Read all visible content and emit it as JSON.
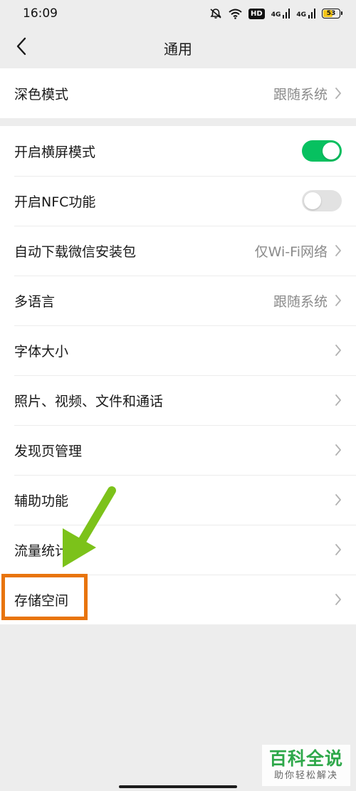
{
  "status_bar": {
    "time": "16:09",
    "hd_label": "HD",
    "network_1": "4G",
    "network_2": "4G",
    "battery": "53"
  },
  "nav": {
    "title": "通用"
  },
  "group1": [
    {
      "label": "深色模式",
      "value": "跟随系统"
    }
  ],
  "group2": [
    {
      "label": "开启横屏模式",
      "toggle": true
    },
    {
      "label": "开启NFC功能",
      "toggle": false
    },
    {
      "label": "自动下载微信安装包",
      "value": "仅Wi-Fi网络"
    },
    {
      "label": "多语言",
      "value": "跟随系统"
    },
    {
      "label": "字体大小"
    },
    {
      "label": "照片、视频、文件和通话"
    },
    {
      "label": "发现页管理"
    },
    {
      "label": "辅助功能"
    },
    {
      "label": "流量统计"
    },
    {
      "label": "存储空间"
    }
  ],
  "watermark": {
    "title": "百科全说",
    "subtitle": "助你轻松解决"
  },
  "colors": {
    "accent": "#07c160",
    "highlight": "#e8740c",
    "arrow": "#7cc21a"
  },
  "icons": {
    "back": "chevron-left-icon",
    "row_arrow": "chevron-right-icon"
  }
}
